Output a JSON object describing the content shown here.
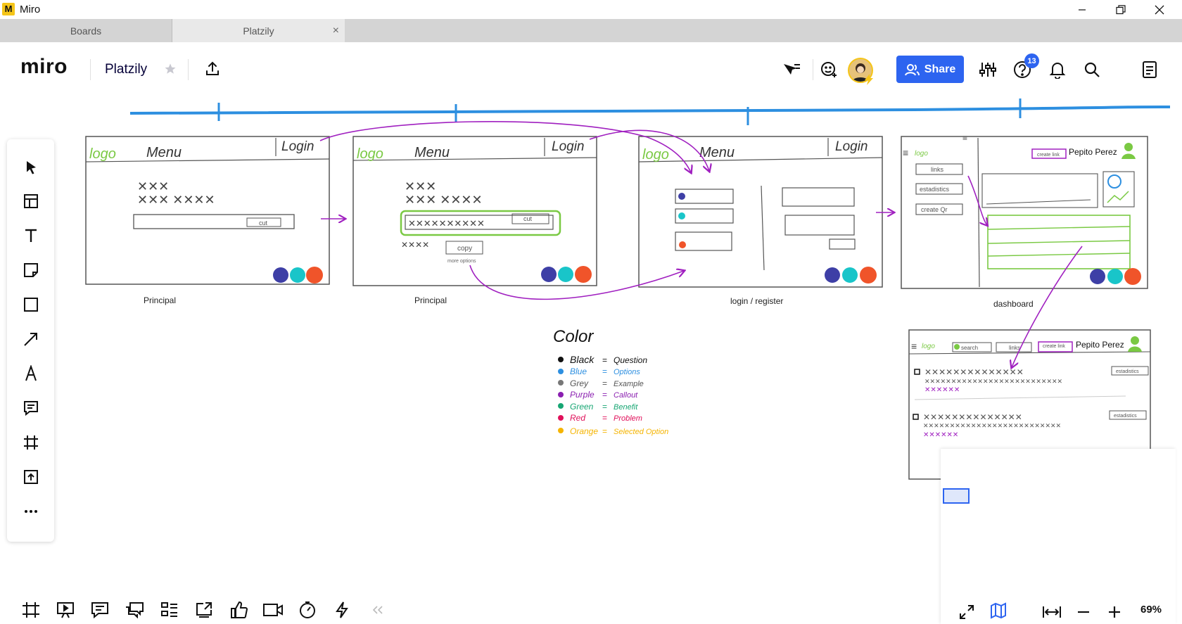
{
  "window": {
    "app_name": "Miro",
    "app_logo_glyph": "M"
  },
  "tabs": [
    {
      "label": "Boards"
    },
    {
      "label": "Platzily"
    }
  ],
  "header": {
    "logo": "miro",
    "board_name": "Platzily",
    "share_label": "Share",
    "help_badge_count": "13"
  },
  "canvas": {
    "frames": [
      {
        "caption": "Principal"
      },
      {
        "caption": "Principal"
      },
      {
        "caption": "login / register"
      },
      {
        "caption": "dashboard"
      }
    ],
    "sketch_text": {
      "logo": "logo",
      "menu": "Menu",
      "login": "Login",
      "cut": "cut",
      "copy": "copy",
      "more_options": "more options",
      "user_name": "Pepito Perez",
      "create_link": "create link",
      "links": "links",
      "estadistics": "estadistics",
      "create_qr": "create Qr",
      "search": "search"
    },
    "legend": {
      "title": "Color",
      "items": [
        {
          "name": "Black",
          "meaning": "Question",
          "color": "#111111"
        },
        {
          "name": "Blue",
          "meaning": "Options",
          "color": "#2d8fe0"
        },
        {
          "name": "Grey",
          "meaning": "Example",
          "color": "#777777"
        },
        {
          "name": "Purple",
          "meaning": "Callout",
          "color": "#8a1fb0"
        },
        {
          "name": "Green",
          "meaning": "Benefit",
          "color": "#17a673"
        },
        {
          "name": "Red",
          "meaning": "Problem",
          "color": "#e0105a"
        },
        {
          "name": "Orange",
          "meaning": "Selected Option",
          "color": "#f5b400"
        }
      ]
    }
  },
  "zoom": {
    "level": "69%"
  },
  "colors": {
    "accent": "#2d64f0",
    "timeline": "#2d8fe0",
    "sketch_green": "#7ac943",
    "sketch_purple": "#a020c0",
    "dot_navy": "#3e3fa6",
    "dot_cyan": "#19c5c9",
    "dot_orange": "#f0542a"
  },
  "icons": {
    "left_toolbar": [
      "select-cursor-icon",
      "templates-icon",
      "text-icon",
      "sticky-note-icon",
      "shape-icon",
      "arrow-line-icon",
      "pen-icon",
      "comment-icon",
      "frame-icon",
      "upload-icon",
      "more-tools-icon"
    ],
    "bottom_toolbar": [
      "frames-icon",
      "presentation-icon",
      "comments-icon",
      "chat-icon",
      "card-list-icon",
      "screen-share-icon",
      "reactions-icon",
      "video-call-icon",
      "timer-icon",
      "activity-icon",
      "collapse-icon"
    ]
  }
}
